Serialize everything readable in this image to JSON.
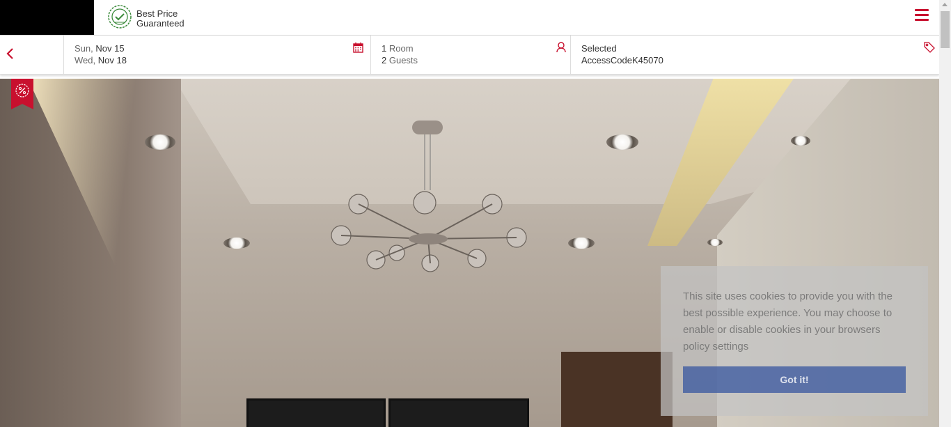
{
  "header": {
    "badge_line1": "Best Price",
    "badge_line2": "Guaranteed",
    "badge_icon": "verified-check-icon",
    "menu_icon": "hamburger-icon",
    "accent_color": "#c8102e"
  },
  "booking": {
    "back_icon": "chevron-left-icon",
    "checkin_day": "Sun,",
    "checkin_date": "Nov 15",
    "checkout_day": "Wed,",
    "checkout_date": "Nov 18",
    "calendar_icon": "calendar-icon",
    "rooms_count": "1",
    "rooms_label": "Room",
    "guests_count": "2",
    "guests_label": "Guests",
    "guest_icon": "user-icon",
    "code_label": "Selected",
    "code_value": "AccessCodeK45070",
    "tag_icon": "tag-icon"
  },
  "promo": {
    "icon": "discount-badge-icon"
  },
  "cookie": {
    "message": "This site uses cookies to provide you with the best possible experience. You may choose to enable or disable cookies in your browsers policy settings",
    "button_label": "Got it!"
  }
}
